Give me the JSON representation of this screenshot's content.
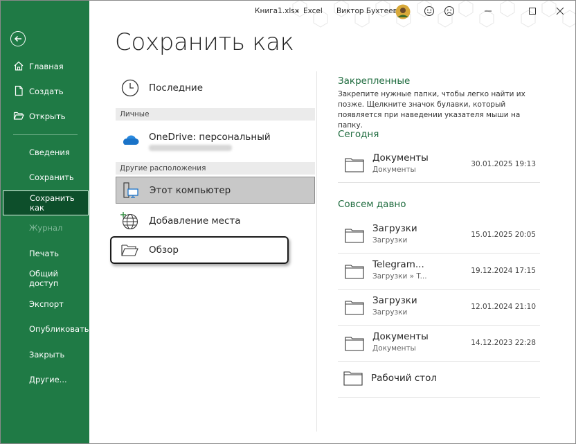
{
  "titlebar": {
    "file": "Книга1.xlsx",
    "separator": "-",
    "app": "Excel",
    "user": "Виктор Бухтеев"
  },
  "sidebar": {
    "items": [
      {
        "label": "Главная",
        "icon": "home-icon"
      },
      {
        "label": "Создать",
        "icon": "new-document-icon"
      },
      {
        "label": "Открыть",
        "icon": "open-folder-icon"
      },
      {
        "label": "Сведения"
      },
      {
        "label": "Сохранить"
      },
      {
        "label": "Сохранить как",
        "active": true
      },
      {
        "label": "Журнал",
        "disabled": true
      },
      {
        "label": "Печать"
      },
      {
        "label": "Общий доступ"
      },
      {
        "label": "Экспорт"
      },
      {
        "label": "Опубликовать"
      },
      {
        "label": "Закрыть"
      },
      {
        "label": "Другие..."
      }
    ]
  },
  "page": {
    "title": "Сохранить как"
  },
  "locations": {
    "recent": "Последние",
    "personal_header": "Личные",
    "onedrive": "OneDrive: персональный",
    "other_header": "Другие расположения",
    "this_pc": "Этот компьютер",
    "add_place": "Добавление места",
    "browse": "Обзор"
  },
  "right": {
    "pinned_header": "Закрепленные",
    "pinned_desc": "Закрепите нужные папки, чтобы легко найти их позже. Щелкните значок булавки, который появляется при наведении указателя мыши на папку.",
    "today_header": "Сегодня",
    "today": [
      {
        "name": "Документы",
        "path": "Документы",
        "date": "30.01.2025 19:13"
      }
    ],
    "older_header": "Совсем давно",
    "older": [
      {
        "name": "Загрузки",
        "path": "Загрузки",
        "date": "15.01.2025 20:05"
      },
      {
        "name": "Telegram...",
        "path": "Загрузки » T...",
        "date": "19.12.2024 17:15"
      },
      {
        "name": "Загрузки",
        "path": "Загрузки",
        "date": "12.01.2024 21:10"
      },
      {
        "name": "Документы",
        "path": "Документы",
        "date": "14.12.2023 22:28"
      },
      {
        "name": "Рабочий стол",
        "path": "",
        "date": ""
      }
    ]
  },
  "colors": {
    "sidebar": "#1f7a45",
    "sidebar_active": "#0d4f2b",
    "accent_text": "#1e6b3e"
  }
}
